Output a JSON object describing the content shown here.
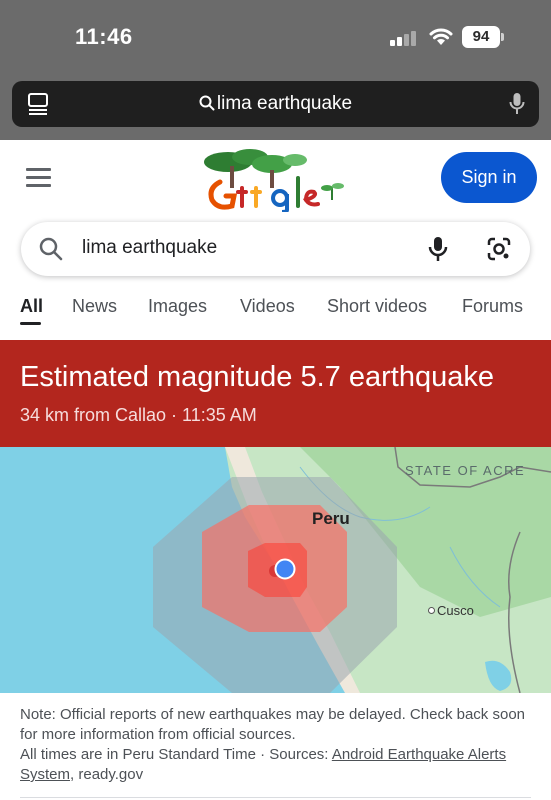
{
  "status_bar": {
    "time": "11:46",
    "battery": "94"
  },
  "address_bar": {
    "query": "lima earthquake"
  },
  "header": {
    "sign_in_label": "Sign in",
    "doodle_icon": "google-doodle-trees"
  },
  "search": {
    "query": "lima earthquake"
  },
  "tabs": [
    {
      "label": "All",
      "active": true
    },
    {
      "label": "News"
    },
    {
      "label": "Images"
    },
    {
      "label": "Videos"
    },
    {
      "label": "Short videos"
    },
    {
      "label": "Forums"
    }
  ],
  "quake": {
    "title": "Estimated magnitude 5.7 earthquake",
    "subtitle": "34 km from Callao · 11:35 AM",
    "banner_color": "#b3261e"
  },
  "map": {
    "label_region": "STATE OF ACRE",
    "label_country": "Peru",
    "label_city": "Cusco"
  },
  "note": {
    "line1": "Note: Official reports of new earthquakes may be delayed. Check back soon for more information from official sources.",
    "times_prefix": "All times are in Peru Standard Time · Sources: ",
    "source_link": "Android Earthquake Alerts System",
    "source_suffix": ", ready.gov"
  },
  "colors": {
    "accent": "#0b57d0",
    "alert": "#b3261e"
  }
}
